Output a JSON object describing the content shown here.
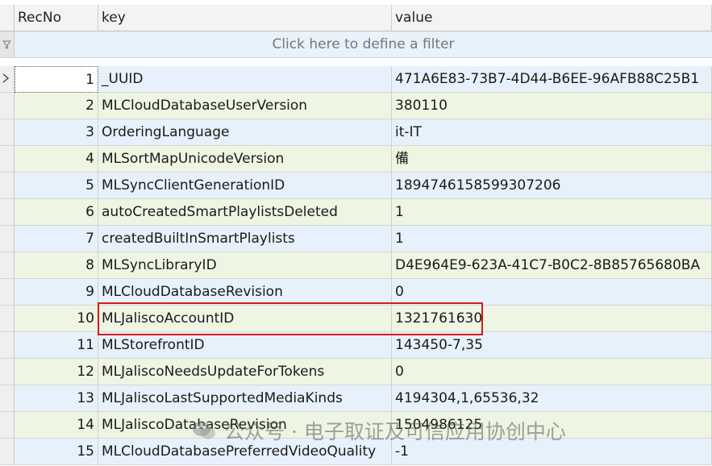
{
  "columns": {
    "recno": "RecNo",
    "key": "key",
    "value": "value"
  },
  "filter_text": "Click here to define a filter",
  "rows": [
    {
      "recno": "1",
      "key": "_UUID",
      "value": "471A6E83-73B7-4D44-B6EE-96AFB88C25B1"
    },
    {
      "recno": "2",
      "key": "MLCloudDatabaseUserVersion",
      "value": "380110"
    },
    {
      "recno": "3",
      "key": "OrderingLanguage",
      "value": "it-IT"
    },
    {
      "recno": "4",
      "key": "MLSortMapUnicodeVersion",
      "value": "備"
    },
    {
      "recno": "5",
      "key": "MLSyncClientGenerationID",
      "value": "1894746158599307206"
    },
    {
      "recno": "6",
      "key": "autoCreatedSmartPlaylistsDeleted",
      "value": "1"
    },
    {
      "recno": "7",
      "key": "createdBuiltInSmartPlaylists",
      "value": "1"
    },
    {
      "recno": "8",
      "key": "MLSyncLibraryID",
      "value": "D4E964E9-623A-41C7-B0C2-8B85765680BA"
    },
    {
      "recno": "9",
      "key": "MLCloudDatabaseRevision",
      "value": "0"
    },
    {
      "recno": "10",
      "key": "MLJaliscoAccountID",
      "value": "1321761630"
    },
    {
      "recno": "11",
      "key": "MLStorefrontID",
      "value": "143450-7,35"
    },
    {
      "recno": "12",
      "key": "MLJaliscoNeedsUpdateForTokens",
      "value": "0"
    },
    {
      "recno": "13",
      "key": "MLJaliscoLastSupportedMediaKinds",
      "value": "4194304,1,65536,32"
    },
    {
      "recno": "14",
      "key": "MLJaliscoDatabaseRevision",
      "value": "1504986125"
    },
    {
      "recno": "15",
      "key": "MLCloudDatabasePreferredVideoQuality",
      "value": "-1"
    }
  ],
  "watermark": "公众号 · 电子取证及可信应用协创中心",
  "colors": {
    "highlight": "#d41c1c",
    "row_blue": "#e7f1fb",
    "row_green": "#eef5e3",
    "filter_bg": "#e8f2fb"
  }
}
